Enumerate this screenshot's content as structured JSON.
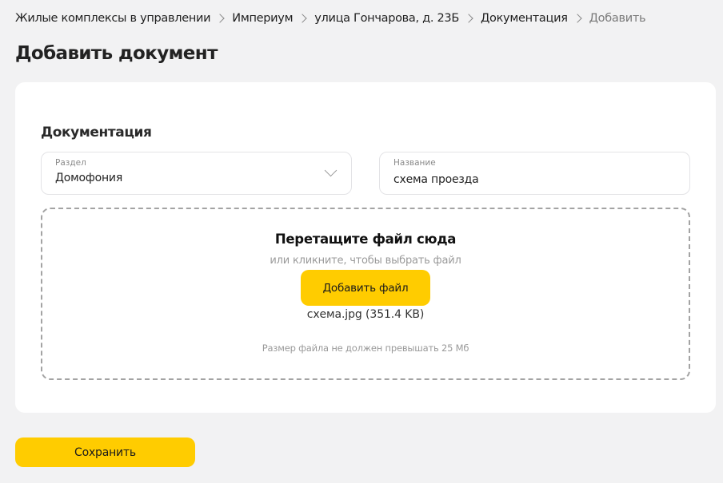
{
  "breadcrumb": {
    "items": [
      {
        "label": "Жилые комплексы в управлении"
      },
      {
        "label": "Империум"
      },
      {
        "label": "улица Гончарова, д. 23Б"
      },
      {
        "label": "Документация"
      },
      {
        "label": "Добавить"
      }
    ]
  },
  "page": {
    "title": "Добавить документ"
  },
  "form": {
    "section_title": "Документация",
    "section_field": {
      "label": "Раздел",
      "value": "Домофония",
      "icon": "chevron-down-icon"
    },
    "name_field": {
      "label": "Название",
      "value": "схема проезда"
    },
    "dropzone": {
      "title": "Перетащите файл сюда",
      "subtitle": "или кликните, чтобы выбрать файл",
      "button_label": "Добавить файл",
      "file_info": "схема.jpg (351.4 KB)",
      "size_hint": "Размер файла не должен превышать 25 Мб"
    }
  },
  "actions": {
    "save_label": "Сохранить"
  },
  "colors": {
    "accent": "#ffcc00",
    "background": "#f2f2f3",
    "card": "#ffffff"
  }
}
